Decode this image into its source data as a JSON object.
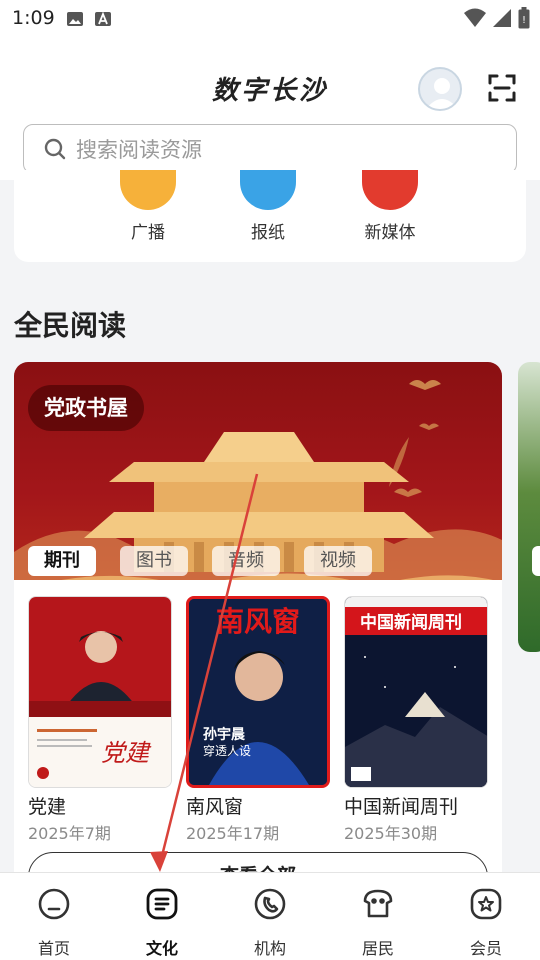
{
  "status": {
    "time": "1:09"
  },
  "header": {
    "title": "数字长沙",
    "search_placeholder": "搜索阅读资源"
  },
  "categories": [
    {
      "label": "广播",
      "color": "#f6b13a"
    },
    {
      "label": "报纸",
      "color": "#3aa3e6"
    },
    {
      "label": "新媒体",
      "color": "#e23b2e"
    }
  ],
  "section": {
    "title": "全民阅读"
  },
  "banner": {
    "tag": "党政书屋",
    "tabs": [
      "期刊",
      "图书",
      "音频",
      "视频"
    ],
    "active_tab": "期刊"
  },
  "magazines": [
    {
      "title": "党建",
      "issue": "2025年7期"
    },
    {
      "title": "南风窗",
      "issue": "2025年17期",
      "cover_text": "南风窗",
      "cover_caption": "孙宇晨",
      "cover_subcaption": "穿透人设"
    },
    {
      "title": "中国新闻周刊",
      "issue": "2025年30期",
      "cover_text": "中国新闻周刊"
    }
  ],
  "view_all_label": "查看全部",
  "nav": [
    {
      "label": "首页",
      "icon": "home-icon"
    },
    {
      "label": "文化",
      "icon": "culture-icon"
    },
    {
      "label": "机构",
      "icon": "institution-icon"
    },
    {
      "label": "居民",
      "icon": "resident-icon"
    },
    {
      "label": "会员",
      "icon": "member-icon"
    }
  ],
  "nav_active": "文化",
  "colors": {
    "banner_red": "#a3161a",
    "annotation_arrow": "#d9423a"
  }
}
